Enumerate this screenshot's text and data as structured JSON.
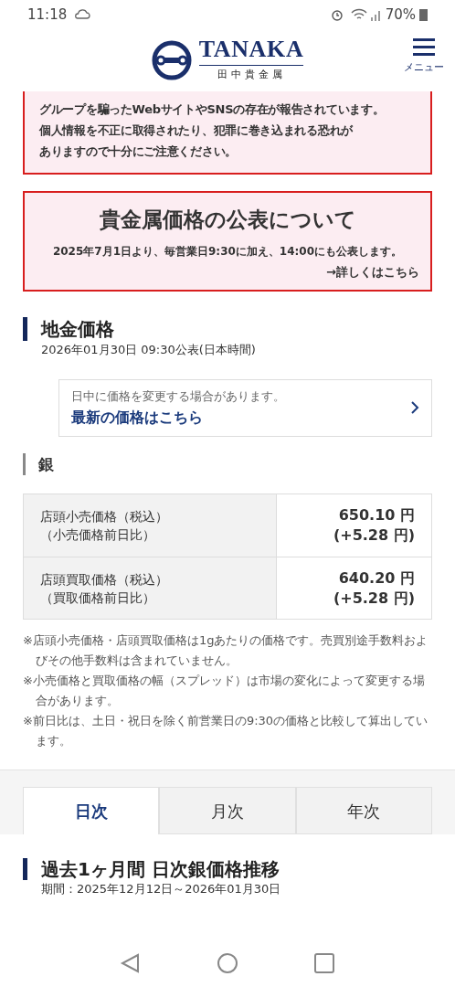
{
  "status_bar": {
    "time": "11:18",
    "battery": "70%"
  },
  "header": {
    "logo_text": "TANAKA",
    "logo_subtext": "田中貴金属",
    "menu_label": "メニュー"
  },
  "warning": {
    "lines": [
      "グループを騙ったWebサイトやSNSの存在が報告されています。",
      "個人情報を不正に取得されたり、犯罪に巻き込まれる恐れが",
      "ありますので十分にご注意ください。"
    ]
  },
  "notice": {
    "title": "貴金属価格の公表について",
    "body": "2025年7月1日より、毎営業日9:30に加え、14:00にも公表します。",
    "link": "→詳しくはこちら"
  },
  "section": {
    "title": "地金価格",
    "published": "2026年01月30日 09:30公表(日本時間)"
  },
  "latest_card": {
    "note": "日中に価格を変更する場合があります。",
    "link": "最新の価格はこちら"
  },
  "metal": {
    "name": "銀"
  },
  "price_table": {
    "rows": [
      {
        "label": "店頭小売価格（税込）",
        "sublabel": "（小売価格前日比）",
        "price": "650.10 円",
        "change": "(+5.28 円)"
      },
      {
        "label": "店頭買取価格（税込）",
        "sublabel": "（買取価格前日比）",
        "price": "640.20 円",
        "change": "(+5.28 円)"
      }
    ]
  },
  "notes": [
    "※店頭小売価格・店頭買取価格は1gあたりの価格です。売買別途手数料およびその他手数料は含まれていません。",
    "※小売価格と買取価格の幅（スプレッド）は市場の変化によって変更する場合があります。",
    "※前日比は、土日・祝日を除く前営業日の9:30の価格と比較して算出しています。"
  ],
  "tabs": [
    {
      "label": "日次",
      "selected": true
    },
    {
      "label": "月次",
      "selected": false
    },
    {
      "label": "年次",
      "selected": false
    }
  ],
  "chart_section": {
    "title": "過去1ヶ月間 日次銀価格推移",
    "period": "期間：2025年12月12日～2026年01月30日"
  }
}
